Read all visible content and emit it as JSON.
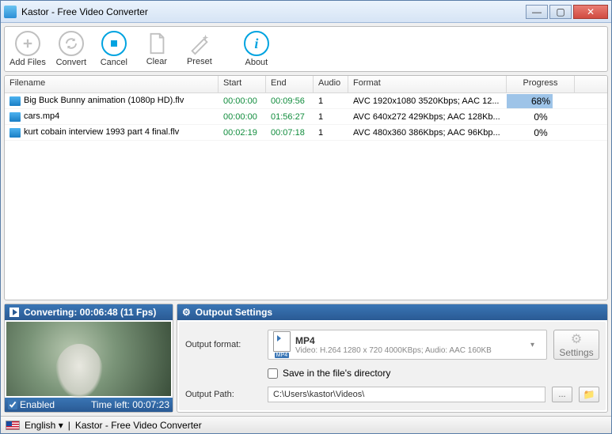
{
  "window": {
    "title": "Kastor - Free Video Converter"
  },
  "toolbar": {
    "add_files": "Add Files",
    "convert": "Convert",
    "cancel": "Cancel",
    "clear": "Clear",
    "preset": "Preset",
    "about": "About"
  },
  "list": {
    "headers": {
      "filename": "Filename",
      "start": "Start",
      "end": "End",
      "audio": "Audio",
      "format": "Format",
      "progress": "Progress"
    },
    "rows": [
      {
        "filename": "Big Buck Bunny animation (1080p HD).flv",
        "start": "00:00:00",
        "end": "00:09:56",
        "audio": "1",
        "format": "AVC 1920x1080 3520Kbps; AAC 12...",
        "progress_pct": 68,
        "progress_label": "68%"
      },
      {
        "filename": "cars.mp4",
        "start": "00:00:00",
        "end": "01:56:27",
        "audio": "1",
        "format": "AVC 640x272 429Kbps; AAC 128Kb...",
        "progress_pct": 0,
        "progress_label": "0%"
      },
      {
        "filename": "kurt cobain interview 1993 part 4 final.flv",
        "start": "00:02:19",
        "end": "00:07:18",
        "audio": "1",
        "format": "AVC 480x360 386Kbps; AAC 96Kbp...",
        "progress_pct": 0,
        "progress_label": "0%"
      }
    ]
  },
  "preview": {
    "status": "Converting: 00:06:48 (11 Fps)",
    "enabled_label": "Enabled",
    "enabled_checked": true,
    "time_left": "Time left:  00:07:23"
  },
  "output": {
    "panel_title": "Outpout Settings",
    "output_format_label": "Output format:",
    "format_name": "MP4",
    "format_badge": "MP4",
    "format_desc": "Video: H.264 1280 x 720 4000KBps; Audio: AAC 160KB",
    "settings_btn": "Settings",
    "save_dir_label": "Save in the file's directory",
    "save_dir_checked": false,
    "output_path_label": "Output Path:",
    "output_path_value": "C:\\Users\\kastor\\Videos\\"
  },
  "statusbar": {
    "language": "English",
    "app": "Kastor - Free Video Converter"
  }
}
